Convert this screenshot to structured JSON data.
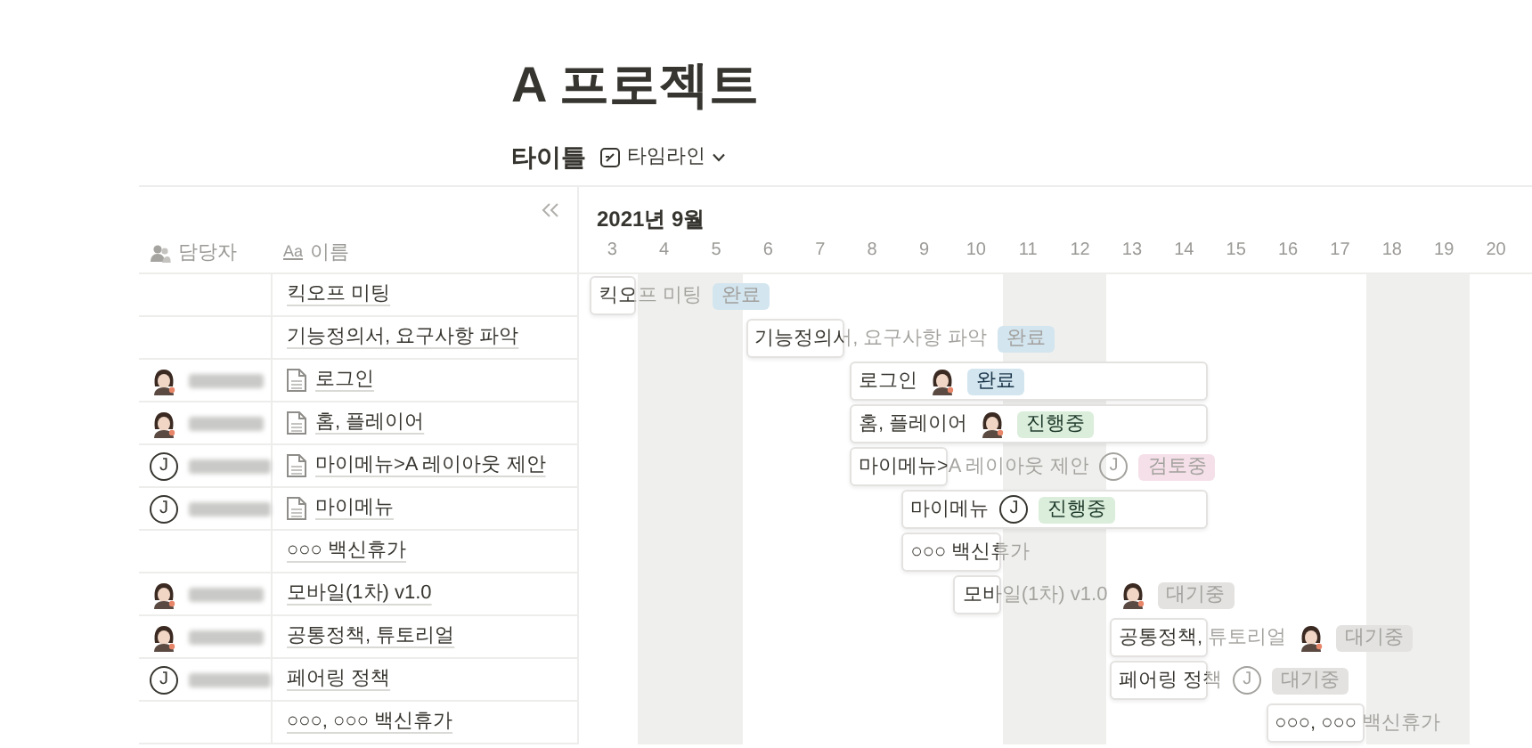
{
  "page": {
    "title": "A 프로젝트"
  },
  "view_bar": {
    "title": "타이틀",
    "view": "타임라인"
  },
  "table": {
    "columns": [
      {
        "kind": "person",
        "label": "담당자"
      },
      {
        "kind": "title",
        "glyph": "Aa",
        "label": "이름"
      }
    ],
    "rows": [
      {
        "name": "킥오프 미팅",
        "page": false
      },
      {
        "name": "기능정의서, 요구사항 파악",
        "page": false
      },
      {
        "name": "로그인",
        "page": true,
        "assignee": {
          "kind": "photo"
        }
      },
      {
        "name": "홈, 플레이어",
        "page": true,
        "assignee": {
          "kind": "photo"
        }
      },
      {
        "name": "마이메뉴>A 레이아웃 제안",
        "page": true,
        "assignee": {
          "kind": "letter",
          "initial": "J"
        }
      },
      {
        "name": "마이메뉴",
        "page": true,
        "assignee": {
          "kind": "letter",
          "initial": "J"
        }
      },
      {
        "name": "○○○ 백신휴가",
        "page": false
      },
      {
        "name": "모바일(1차) v1.0",
        "page": false,
        "assignee": {
          "kind": "photo"
        }
      },
      {
        "name": "공통정책, 튜토리얼",
        "page": false,
        "assignee": {
          "kind": "photo"
        }
      },
      {
        "name": "페어링 정책",
        "page": false,
        "assignee": {
          "kind": "letter",
          "initial": "J"
        }
      },
      {
        "name": "○○○, ○○○ 백신휴가",
        "page": false
      }
    ]
  },
  "timeline": {
    "month": "2021년 9월",
    "days": [
      {
        "label": "3",
        "weekend": false
      },
      {
        "label": "4",
        "weekend": true
      },
      {
        "label": "5",
        "weekend": true
      },
      {
        "label": "6",
        "weekend": false
      },
      {
        "label": "7",
        "weekend": false
      },
      {
        "label": "8",
        "weekend": false
      },
      {
        "label": "9",
        "weekend": false
      },
      {
        "label": "10",
        "weekend": false
      },
      {
        "label": "11",
        "weekend": true
      },
      {
        "label": "12",
        "weekend": true
      },
      {
        "label": "13",
        "weekend": false
      },
      {
        "label": "14",
        "weekend": false
      },
      {
        "label": "15",
        "weekend": false
      },
      {
        "label": "16",
        "weekend": false
      },
      {
        "label": "17",
        "weekend": false
      },
      {
        "label": "18",
        "weekend": true
      },
      {
        "label": "19",
        "weekend": true
      },
      {
        "label": "20",
        "weekend": false
      }
    ],
    "bars": [
      {
        "title": "킥오프 미팅",
        "status": {
          "kind": "done",
          "label": "완료",
          "color": "#d3e5ef"
        }
      },
      {
        "title": "기능정의서, 요구사항 파악",
        "status": {
          "kind": "done",
          "label": "완료",
          "color": "#d3e5ef"
        }
      },
      {
        "title": "로그인",
        "avatar": {
          "kind": "photo"
        },
        "status": {
          "kind": "done",
          "label": "완료",
          "color": "#d3e5ef"
        }
      },
      {
        "title": "홈, 플레이어",
        "avatar": {
          "kind": "photo"
        },
        "status": {
          "kind": "progress",
          "label": "진행중",
          "color": "#dbeddb"
        }
      },
      {
        "title": "마이메뉴>A 레이아웃 제안",
        "avatar": {
          "kind": "letter",
          "initial": "J"
        },
        "status": {
          "kind": "review",
          "label": "검토중",
          "color": "#f5e0e9"
        }
      },
      {
        "title": "마이메뉴",
        "avatar": {
          "kind": "letter",
          "initial": "J"
        },
        "status": {
          "kind": "progress",
          "label": "진행중",
          "color": "#dbeddb"
        }
      },
      {
        "title": "○○○ 백신휴가"
      },
      {
        "title": "모바일(1차) v1.0",
        "avatar": {
          "kind": "photo"
        },
        "status": {
          "kind": "waiting",
          "label": "대기중",
          "color": "#e3e2e0"
        }
      },
      {
        "title": "공통정책, 튜토리얼",
        "avatar": {
          "kind": "photo"
        },
        "status": {
          "kind": "waiting",
          "label": "대기중",
          "color": "#e3e2e0"
        }
      },
      {
        "title": "페어링 정책",
        "avatar": {
          "kind": "letter",
          "initial": "J"
        },
        "status": {
          "kind": "waiting",
          "label": "대기중",
          "color": "#e3e2e0"
        }
      },
      {
        "title": "○○○, ○○○ 백신휴가"
      }
    ]
  }
}
